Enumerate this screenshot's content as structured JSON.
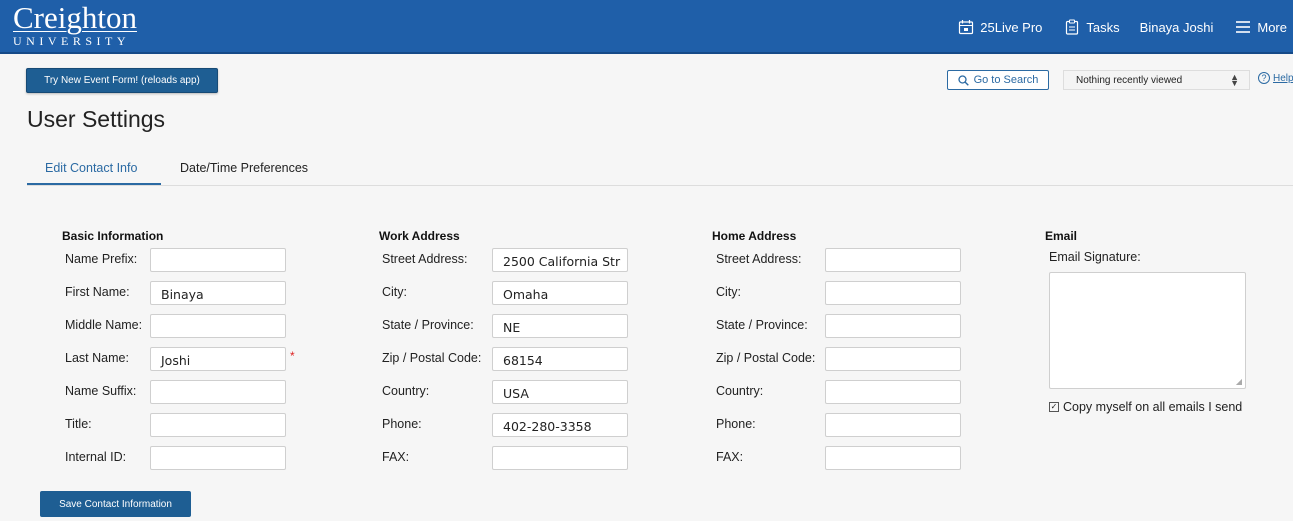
{
  "header": {
    "logo_main": "Creighton",
    "logo_sub": "UNIVERSITY",
    "nav": {
      "pro_label": "25Live Pro",
      "tasks_label": "Tasks",
      "user_name": "Binaya Joshi",
      "more_label": "More"
    }
  },
  "toolbar": {
    "try_new_label": "Try New Event Form! (reloads app)",
    "search_label": "Go to Search",
    "recent_selected": "Nothing recently viewed",
    "help_label": "Help"
  },
  "page": {
    "title": "User Settings"
  },
  "tabs": [
    {
      "label": "Edit Contact Info",
      "active": true
    },
    {
      "label": "Date/Time Preferences",
      "active": false
    }
  ],
  "basic": {
    "heading": "Basic Information",
    "prefix_label": "Name Prefix:",
    "prefix_value": "",
    "first_label": "First Name:",
    "first_value": "Binaya",
    "middle_label": "Middle Name:",
    "middle_value": "",
    "last_label": "Last Name:",
    "last_value": "Joshi",
    "required_mark": "*",
    "suffix_label": "Name Suffix:",
    "suffix_value": "",
    "title_label": "Title:",
    "title_value": "",
    "internal_label": "Internal ID:",
    "internal_value": ""
  },
  "work": {
    "heading": "Work Address",
    "street_label": "Street Address:",
    "street_value": "2500 California Str",
    "city_label": "City:",
    "city_value": "Omaha",
    "state_label": "State / Province:",
    "state_value": "NE",
    "zip_label": "Zip / Postal Code:",
    "zip_value": "68154",
    "country_label": "Country:",
    "country_value": "USA",
    "phone_label": "Phone:",
    "phone_value": "402-280-3358",
    "fax_label": "FAX:",
    "fax_value": ""
  },
  "home": {
    "heading": "Home Address",
    "street_label": "Street Address:",
    "street_value": "",
    "city_label": "City:",
    "city_value": "",
    "state_label": "State / Province:",
    "state_value": "",
    "zip_label": "Zip / Postal Code:",
    "zip_value": "",
    "country_label": "Country:",
    "country_value": "",
    "phone_label": "Phone:",
    "phone_value": "",
    "fax_label": "FAX:",
    "fax_value": ""
  },
  "email": {
    "heading": "Email",
    "signature_label": "Email Signature:",
    "signature_value": "",
    "copy_label": "Copy myself on all emails I send",
    "copy_checked": true
  },
  "actions": {
    "save_label": "Save Contact Information"
  },
  "colors": {
    "header_bg": "#1f5fa9",
    "primary_button": "#1e5e93",
    "link": "#2b6aa3",
    "required": "#dd2222"
  }
}
